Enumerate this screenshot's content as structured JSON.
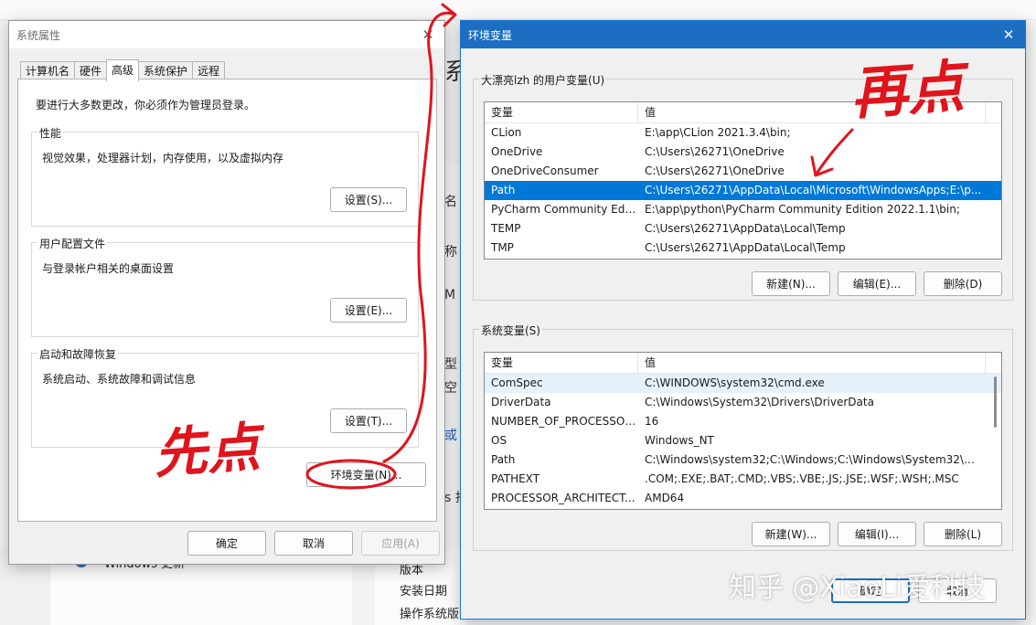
{
  "background": {
    "windows_update": "Windows 更新",
    "version": "版本",
    "install_date": "安装日期",
    "os_version": "操作系统版",
    "big_char": "系",
    "side_fragments": [
      "名",
      "称",
      "M",
      "型",
      "空",
      "或",
      "s 找"
    ]
  },
  "system_properties": {
    "title": "系统属性",
    "close": "✕",
    "tabs": [
      "计算机名",
      "硬件",
      "高级",
      "系统保护",
      "远程"
    ],
    "notice": "要进行大多数更改，你必须作为管理员登录。",
    "performance": {
      "label": "性能",
      "desc": "视觉效果，处理器计划，内存使用，以及虚拟内存",
      "button": "设置(S)..."
    },
    "profiles": {
      "label": "用户配置文件",
      "desc": "与登录帐户相关的桌面设置",
      "button": "设置(E)..."
    },
    "startup": {
      "label": "启动和故障恢复",
      "desc": "系统启动、系统故障和调试信息",
      "button": "设置(T)..."
    },
    "env_button": "环境变量(N)...",
    "ok": "确定",
    "cancel": "取消",
    "apply": "应用(A)"
  },
  "env_vars": {
    "title": "环境变量",
    "close": "✕",
    "user": {
      "label": "大漂亮lzh 的用户变量(U)",
      "col_var": "变量",
      "col_val": "值",
      "rows": [
        {
          "name": "CLion",
          "value": "E:\\app\\CLion 2021.3.4\\bin;"
        },
        {
          "name": "OneDrive",
          "value": "C:\\Users\\26271\\OneDrive"
        },
        {
          "name": "OneDriveConsumer",
          "value": "C:\\Users\\26271\\OneDrive"
        },
        {
          "name": "Path",
          "value": "C:\\Users\\26271\\AppData\\Local\\Microsoft\\WindowsApps;E:\\p..."
        },
        {
          "name": "PyCharm Community Editi...",
          "value": "E:\\app\\python\\PyCharm Community Edition 2022.1.1\\bin;"
        },
        {
          "name": "TEMP",
          "value": "C:\\Users\\26271\\AppData\\Local\\Temp"
        },
        {
          "name": "TMP",
          "value": "C:\\Users\\26271\\AppData\\Local\\Temp"
        }
      ],
      "new": "新建(N)...",
      "edit": "编辑(E)...",
      "delete": "删除(D)"
    },
    "system": {
      "label": "系统变量(S)",
      "col_var": "变量",
      "col_val": "值",
      "rows": [
        {
          "name": "ComSpec",
          "value": "C:\\WINDOWS\\system32\\cmd.exe"
        },
        {
          "name": "DriverData",
          "value": "C:\\Windows\\System32\\Drivers\\DriverData"
        },
        {
          "name": "NUMBER_OF_PROCESSORS",
          "value": "16"
        },
        {
          "name": "OS",
          "value": "Windows_NT"
        },
        {
          "name": "Path",
          "value": "C:\\Windows\\system32;C:\\Windows;C:\\Windows\\System32\\Wb..."
        },
        {
          "name": "PATHEXT",
          "value": ".COM;.EXE;.BAT;.CMD;.VBS;.VBE;.JS;.JSE;.WSF;.WSH;.MSC"
        },
        {
          "name": "PROCESSOR_ARCHITECT...",
          "value": "AMD64"
        }
      ],
      "new": "新建(W)...",
      "edit": "编辑(I)...",
      "delete": "删除(L)"
    },
    "ok": "确定",
    "cancel": "取消"
  },
  "annotations": {
    "first": "先点",
    "then": "再点"
  },
  "watermark": "知乎 @XiaoLi爱科技",
  "colors": {
    "accent": "#1b6ec2",
    "selection": "#0078d7",
    "annotation": "#e0141c"
  }
}
